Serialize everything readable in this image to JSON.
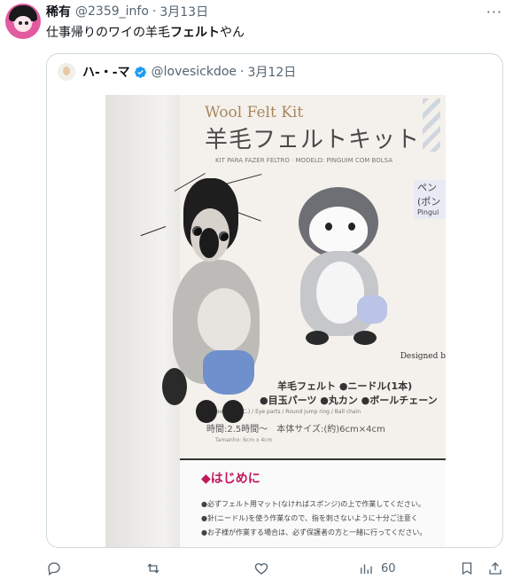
{
  "post": {
    "display_name": "稀有",
    "handle": "@2359_info",
    "separator": "·",
    "date": "3月13日",
    "more": "···",
    "text_before": "仕事帰りのワイの羊毛",
    "text_bold": "フェルト",
    "text_after": "やん"
  },
  "quoted_post": {
    "display_name": "ハ-・-マ",
    "handle": "@lovesickdoe",
    "separator": "·",
    "date": "3月12日",
    "image": {
      "kit_title_en": "Wool Felt Kit",
      "kit_title_jp": "羊毛フェルトキット",
      "kit_subtitle": "KIT PARA FAZER FELTRO · MODELO: PINGUIM COM BOLSA",
      "side_label_1": "ペン",
      "side_label_2": "(ポン",
      "side_label_3": "Pingui",
      "designed_by": "Designed b",
      "contents_line_1": "羊毛フェルト ●ニードル(1本)",
      "contents_line_2": "●目玉パーツ ●丸カン ●ボールチェーン",
      "contents_line_3": "Needle(1PC.) / Eye parts / Round jump ring / Ball chain",
      "time_line": "時間:2.5時間～　本体サイズ:(約)6cm×4cm",
      "size_line": "Tamanho: 6cm x 4cm",
      "intro_title": "◆はじめに",
      "intro_line_1": "●必ずフェルト用マット(なければスポンジ)の上で作業してください。",
      "intro_line_2": "●針(ニードル)を使う作業なので、指を刺さないように十分ご注意く",
      "intro_line_3": "●お子様が作業する場合は、必ず保護者の方と一緒に行ってください。"
    }
  },
  "actions": {
    "reply_count": "",
    "retweet_count": "",
    "like_count": "",
    "views_count": "60"
  },
  "colors": {
    "verified": "#1d9bf0",
    "secondary_text": "#536471",
    "border": "#cfd9de"
  }
}
